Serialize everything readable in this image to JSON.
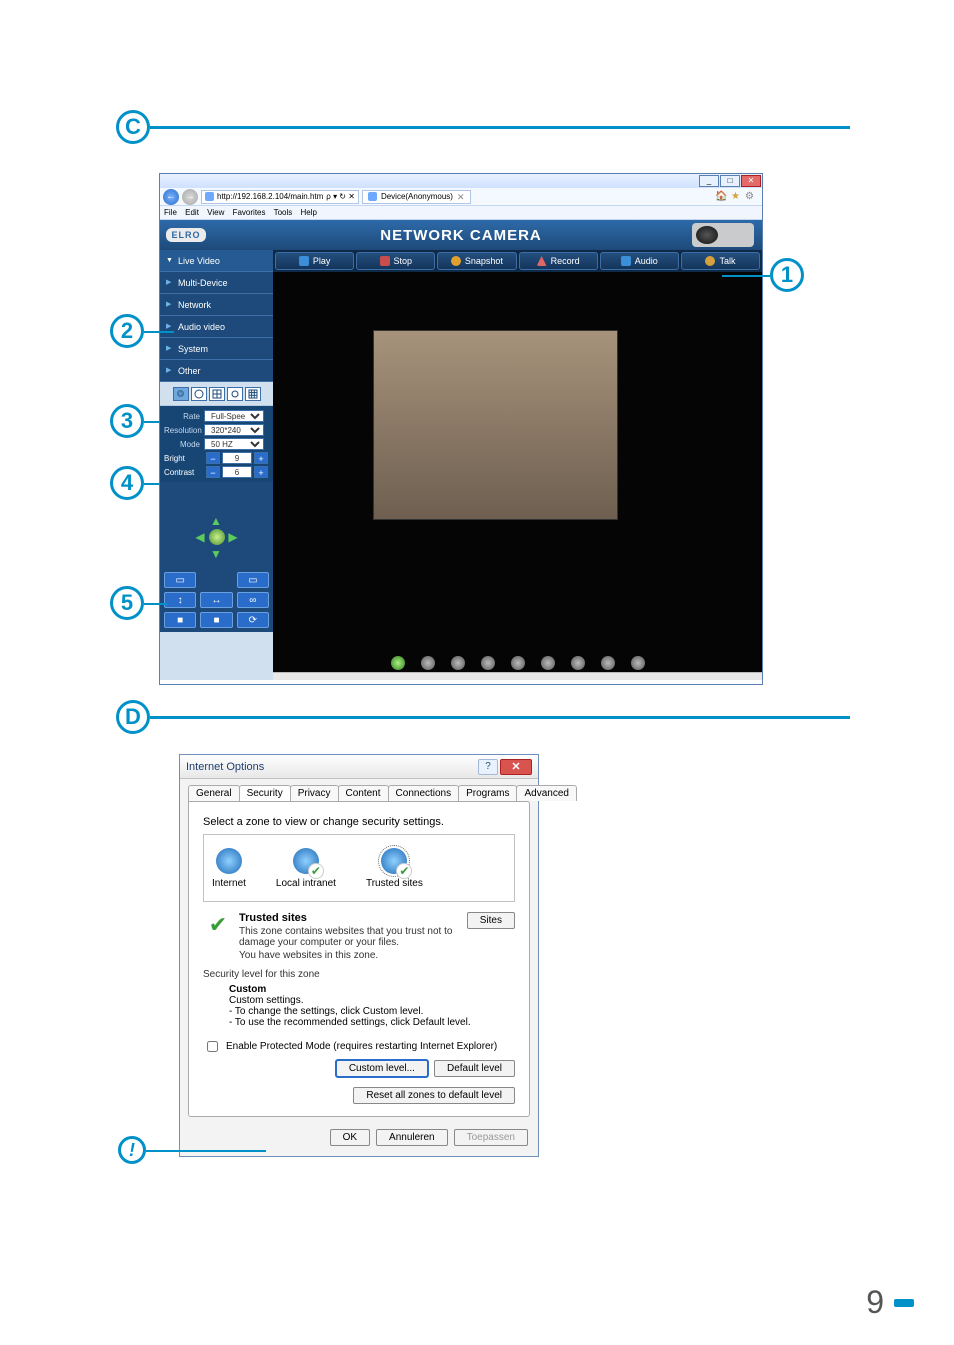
{
  "page_number": "9",
  "section_labels": {
    "C": "C",
    "D": "D",
    "n1": "1",
    "n2": "2",
    "n3": "3",
    "n4": "4",
    "n5": "5",
    "excl": "!"
  },
  "browser": {
    "url": "http://192.168.2.104/main.htm",
    "url_suffix_icons": "ρ ▾ ↻ ✕",
    "tab_title": "Device(Anonymous)",
    "menu": {
      "file": "File",
      "edit": "Edit",
      "view": "View",
      "favorites": "Favorites",
      "tools": "Tools",
      "help": "Help"
    },
    "logo": "ELRO",
    "title": "NETWORK CAMERA",
    "toolbar": {
      "play": "Play",
      "stop": "Stop",
      "snapshot": "Snapshot",
      "record": "Record",
      "audio": "Audio",
      "talk": "Talk"
    },
    "sidebar": {
      "items": [
        {
          "label": "Live Video"
        },
        {
          "label": "Multi-Device"
        },
        {
          "label": "Network"
        },
        {
          "label": "Audio video"
        },
        {
          "label": "System"
        },
        {
          "label": "Other"
        }
      ]
    },
    "settings": {
      "rate_label": "Rate",
      "rate_value": "Full-Speed",
      "resolution_label": "Resolution",
      "resolution_value": "320*240",
      "mode_label": "Mode",
      "mode_value": "50 HZ",
      "bright_label": "Bright",
      "bright_value": "9",
      "contrast_label": "Contrast",
      "contrast_value": "6",
      "minus": "−",
      "plus": "+"
    }
  },
  "internet_options": {
    "title": "Internet Options",
    "tabs": [
      "General",
      "Security",
      "Privacy",
      "Content",
      "Connections",
      "Programs",
      "Advanced"
    ],
    "active_tab": "Security",
    "select_zone_text": "Select a zone to view or change security settings.",
    "zones": [
      {
        "label": "Internet"
      },
      {
        "label": "Local intranet"
      },
      {
        "label": "Trusted sites"
      }
    ],
    "zone_name": "Trusted sites",
    "zone_desc1": "This zone contains websites that you trust not to damage your computer or your files.",
    "zone_desc2": "You have websites in this zone.",
    "sites_button": "Sites",
    "sec_level_heading": "Security level for this zone",
    "custom_heading": "Custom",
    "custom_sub": "Custom settings.",
    "custom_line1": "- To change the settings, click Custom level.",
    "custom_line2": "- To use the recommended settings, click Default level.",
    "epm_label": "Enable Protected Mode (requires restarting Internet Explorer)",
    "custom_level_btn": "Custom level...",
    "default_level_btn": "Default level",
    "reset_btn": "Reset all zones to default level",
    "ok_btn": "OK",
    "cancel_btn": "Annuleren",
    "apply_btn": "Toepassen",
    "close_x": "✕",
    "help_q": "?"
  }
}
